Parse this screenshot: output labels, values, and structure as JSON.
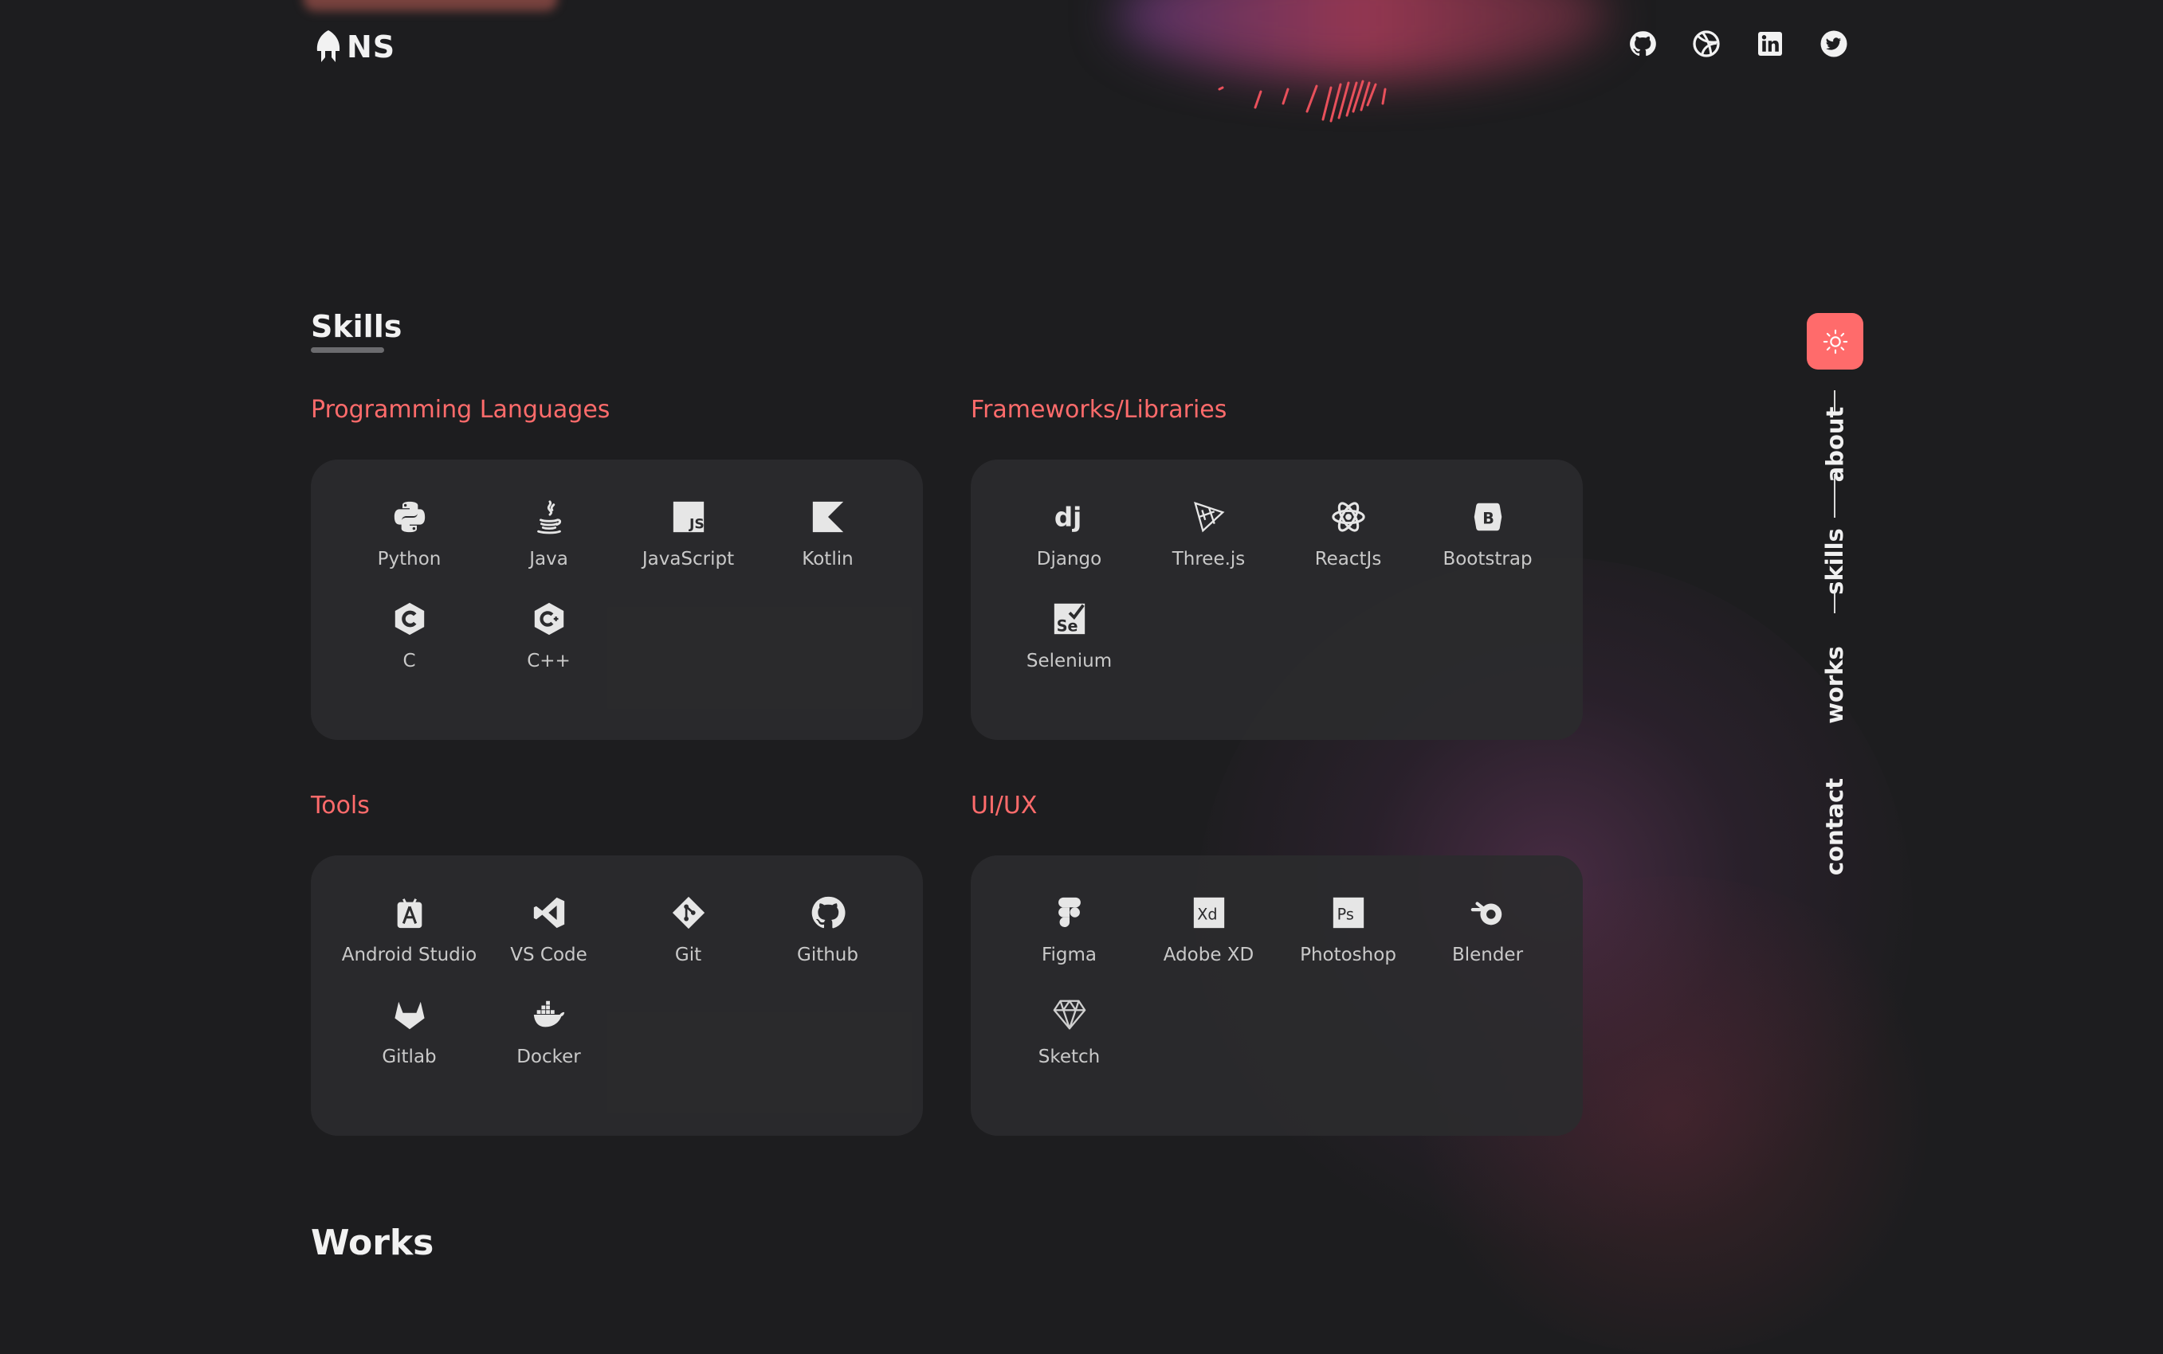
{
  "brand": {
    "name": "NS"
  },
  "socials": [
    {
      "icon": "github-icon"
    },
    {
      "icon": "dribbble-icon"
    },
    {
      "icon": "linkedin-icon"
    },
    {
      "icon": "twitter-icon"
    }
  ],
  "skills": {
    "title": "Skills",
    "categories": [
      {
        "title": "Programming Languages",
        "items": [
          {
            "label": "Python",
            "icon": "python-icon"
          },
          {
            "label": "Java",
            "icon": "java-icon"
          },
          {
            "label": "JavaScript",
            "icon": "javascript-icon"
          },
          {
            "label": "Kotlin",
            "icon": "kotlin-icon"
          },
          {
            "label": "C",
            "icon": "c-icon"
          },
          {
            "label": "C++",
            "icon": "cpp-icon"
          }
        ]
      },
      {
        "title": "Frameworks/Libraries",
        "items": [
          {
            "label": "Django",
            "icon": "django-icon"
          },
          {
            "label": "Three.js",
            "icon": "threejs-icon"
          },
          {
            "label": "ReactJs",
            "icon": "react-icon"
          },
          {
            "label": "Bootstrap",
            "icon": "bootstrap-icon"
          },
          {
            "label": "Selenium",
            "icon": "selenium-icon"
          }
        ]
      },
      {
        "title": "Tools",
        "items": [
          {
            "label": "Android Studio",
            "icon": "android-studio-icon"
          },
          {
            "label": "VS Code",
            "icon": "vscode-icon"
          },
          {
            "label": "Git",
            "icon": "git-icon"
          },
          {
            "label": "Github",
            "icon": "github-icon"
          },
          {
            "label": "Gitlab",
            "icon": "gitlab-icon"
          },
          {
            "label": "Docker",
            "icon": "docker-icon"
          }
        ]
      },
      {
        "title": "UI/UX",
        "items": [
          {
            "label": "Figma",
            "icon": "figma-icon"
          },
          {
            "label": "Adobe XD",
            "icon": "adobe-xd-icon"
          },
          {
            "label": "Photoshop",
            "icon": "photoshop-icon"
          },
          {
            "label": "Blender",
            "icon": "blender-icon"
          },
          {
            "label": "Sketch",
            "icon": "sketch-icon"
          }
        ]
      }
    ]
  },
  "sidenav": {
    "theme_toggle_icon": "sun-icon",
    "items": [
      {
        "label": "about",
        "active": false
      },
      {
        "label": "skills",
        "active": true
      },
      {
        "label": "works",
        "active": false
      },
      {
        "label": "contact",
        "active": false
      }
    ]
  },
  "next_section": {
    "title": "Works"
  },
  "colors": {
    "accent": "#ff6b6b",
    "background": "#1d1d1f",
    "card": "#2b2b2d"
  }
}
